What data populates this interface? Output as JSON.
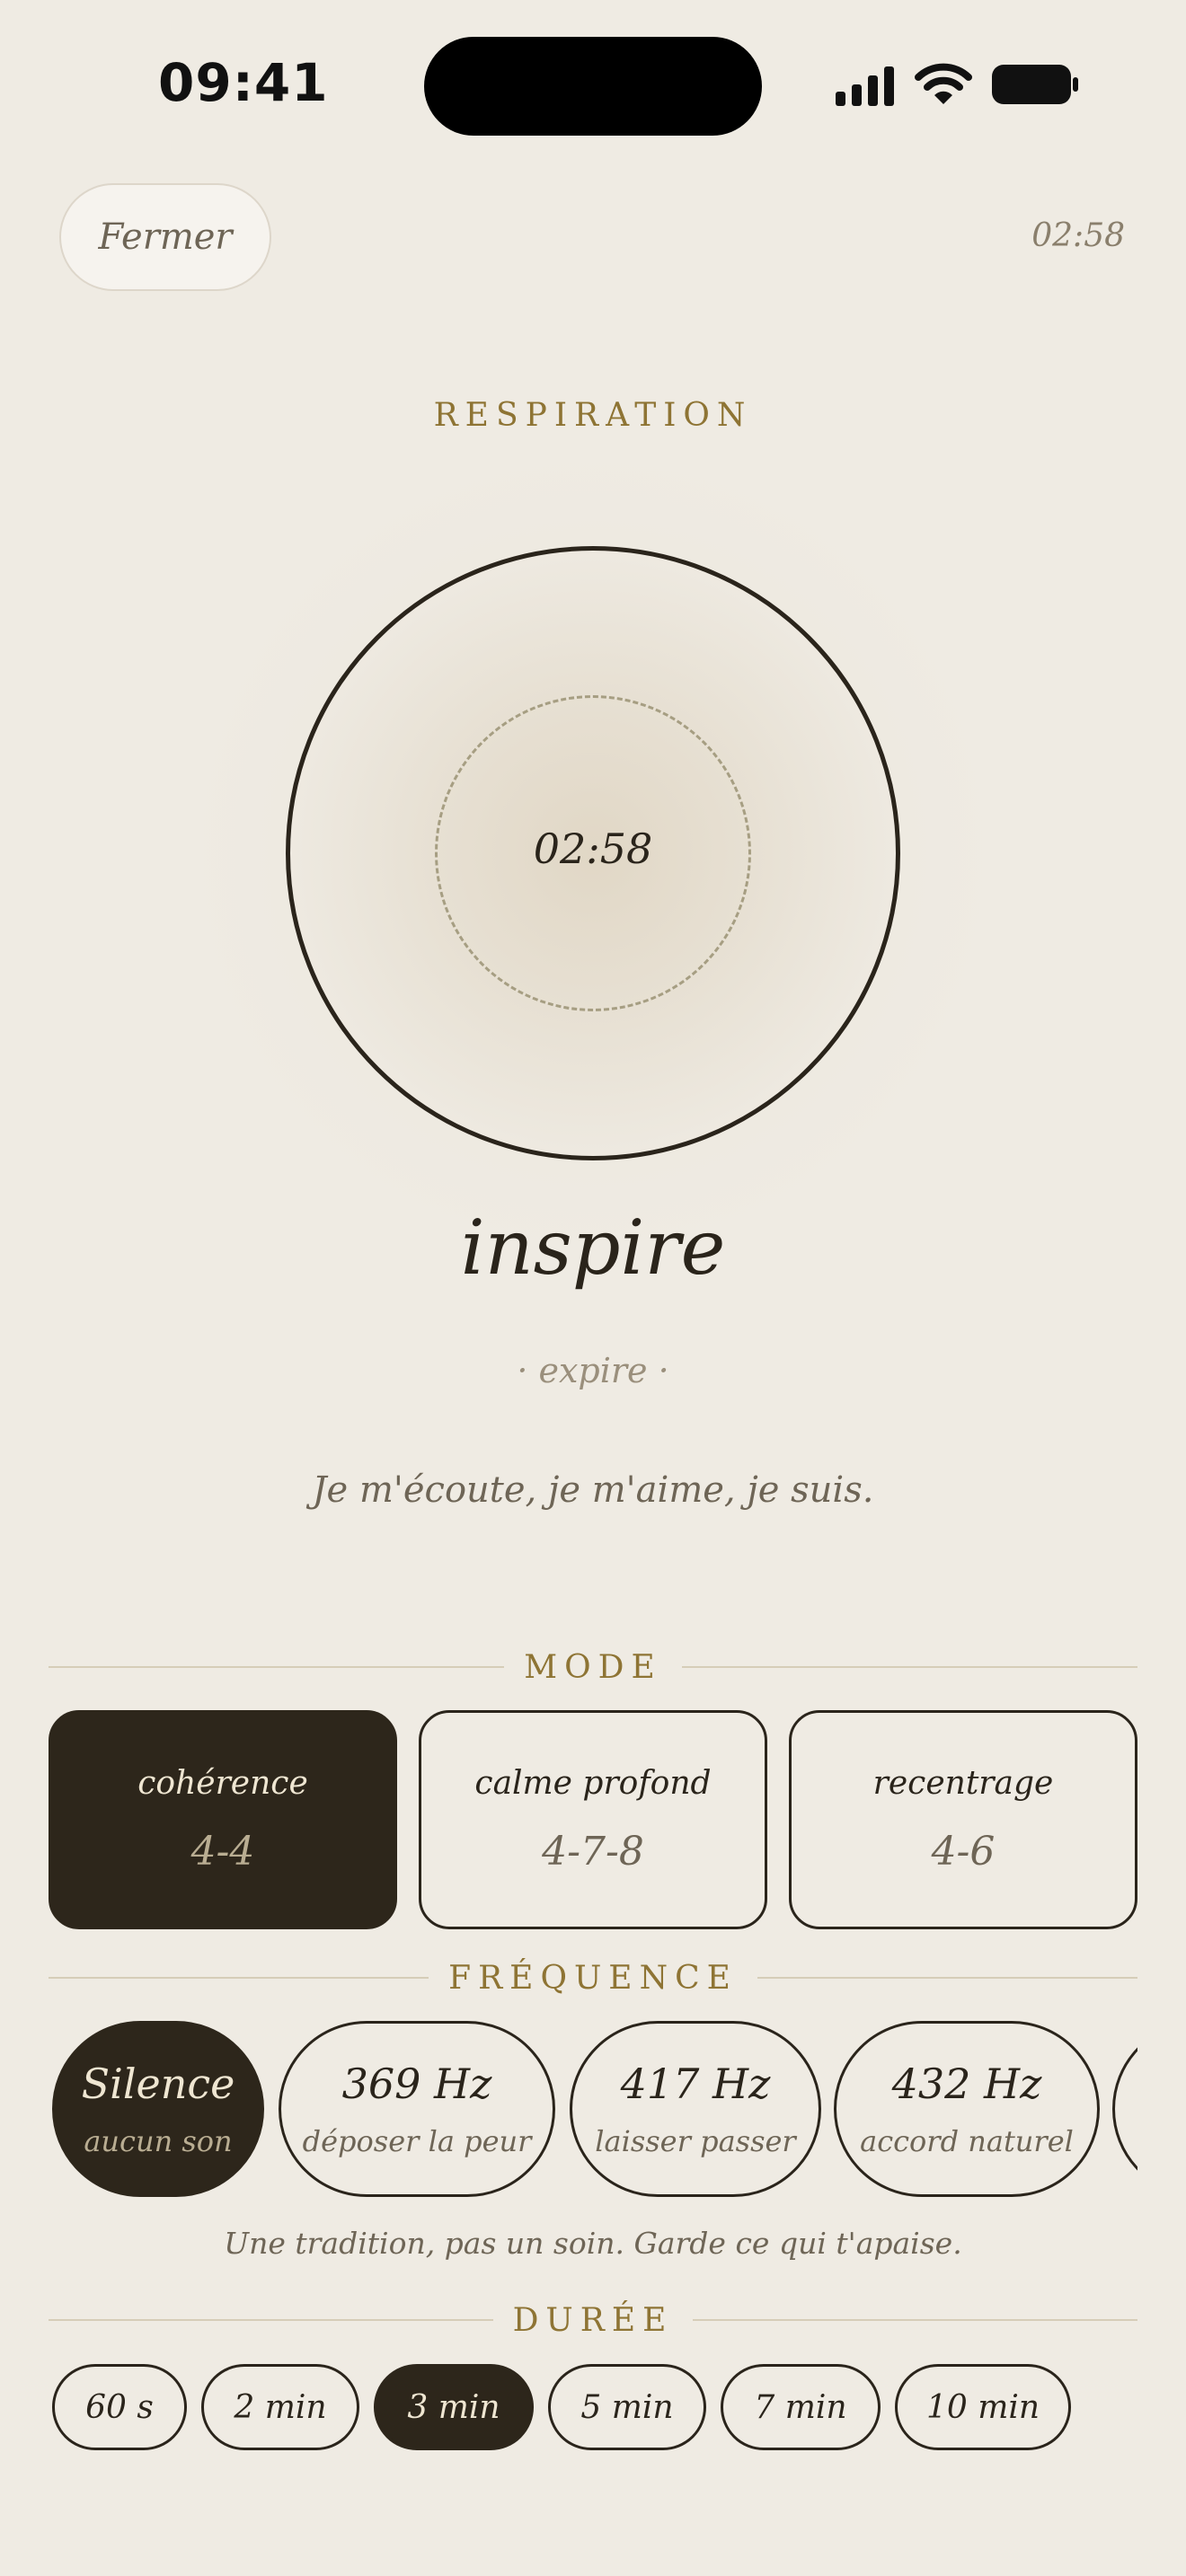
{
  "status_bar": {
    "time": "09:41",
    "icons": [
      "signal-icon",
      "wifi-icon",
      "battery-icon"
    ]
  },
  "header": {
    "close_label": "Fermer",
    "timer": "02:58"
  },
  "breath": {
    "title": "RESPIRATION",
    "center_timer": "02:58",
    "phase": "inspire",
    "next_phase": "· expire ·",
    "affirmation": "Je m'écoute, je m'aime, je suis."
  },
  "mode": {
    "title": "MODE",
    "options": [
      {
        "name": "cohérence",
        "ratio": "4-4",
        "selected": true
      },
      {
        "name": "calme profond",
        "ratio": "4-7-8",
        "selected": false
      },
      {
        "name": "recentrage",
        "ratio": "4-6",
        "selected": false
      }
    ]
  },
  "frequency": {
    "title": "FRÉQUENCE",
    "options": [
      {
        "hz": "Silence",
        "desc": "aucun son",
        "selected": true
      },
      {
        "hz": "369 Hz",
        "desc": "déposer la peur",
        "selected": false
      },
      {
        "hz": "417 Hz",
        "desc": "laisser passer",
        "selected": false
      },
      {
        "hz": "432 Hz",
        "desc": "accord naturel",
        "selected": false
      }
    ],
    "note": "Une tradition, pas un soin. Garde ce qui t'apaise."
  },
  "duration": {
    "title": "DURÉE",
    "options": [
      {
        "label": "60 s",
        "selected": false
      },
      {
        "label": "2 min",
        "selected": false
      },
      {
        "label": "3 min",
        "selected": true
      },
      {
        "label": "5 min",
        "selected": false
      },
      {
        "label": "7 min",
        "selected": false
      },
      {
        "label": "10 min",
        "selected": false
      }
    ]
  },
  "colors": {
    "background": "#efebe3",
    "ink": "#2a241b",
    "accent_gold": "#8e7434",
    "selected_fill": "#2d261b"
  }
}
